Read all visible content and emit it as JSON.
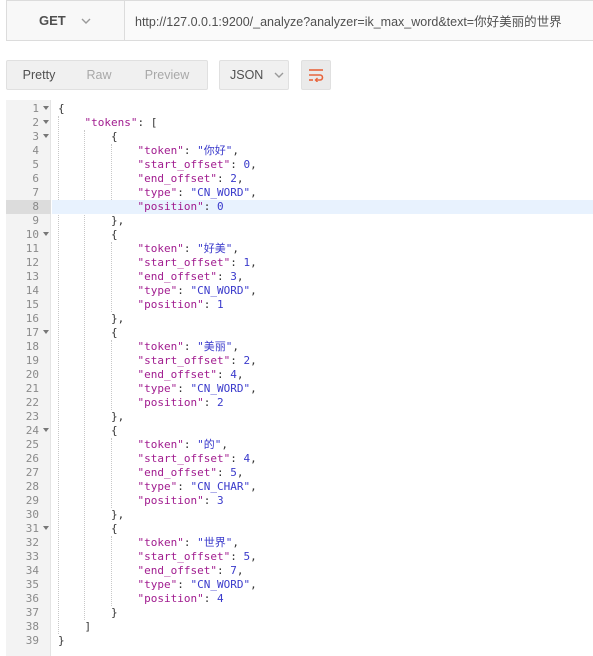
{
  "request": {
    "method": "GET",
    "url": "http://127.0.0.1:9200/_analyze?analyzer=ik_max_word&text=你好美丽的世界"
  },
  "toolbar": {
    "views": [
      "Pretty",
      "Raw",
      "Preview"
    ],
    "active_view": "Pretty",
    "format": "JSON",
    "wrap_icon": "wrap-lines-icon"
  },
  "colors": {
    "key": "#a11c8f",
    "string": "#3a3acb",
    "number": "#3a3acb",
    "punct": "#333333",
    "active_line": "#e8f2fe",
    "wrap_icon": "#e8643c"
  },
  "editor": {
    "active_line": 8,
    "lines": [
      "{",
      "    \"tokens\": [",
      "        {",
      "            \"token\": \"你好\",",
      "            \"start_offset\": 0,",
      "            \"end_offset\": 2,",
      "            \"type\": \"CN_WORD\",",
      "            \"position\": 0",
      "        },",
      "        {",
      "            \"token\": \"好美\",",
      "            \"start_offset\": 1,",
      "            \"end_offset\": 3,",
      "            \"type\": \"CN_WORD\",",
      "            \"position\": 1",
      "        },",
      "        {",
      "            \"token\": \"美丽\",",
      "            \"start_offset\": 2,",
      "            \"end_offset\": 4,",
      "            \"type\": \"CN_WORD\",",
      "            \"position\": 2",
      "        },",
      "        {",
      "            \"token\": \"的\",",
      "            \"start_offset\": 4,",
      "            \"end_offset\": 5,",
      "            \"type\": \"CN_CHAR\",",
      "            \"position\": 3",
      "        },",
      "        {",
      "            \"token\": \"世界\",",
      "            \"start_offset\": 5,",
      "            \"end_offset\": 7,",
      "            \"type\": \"CN_WORD\",",
      "            \"position\": 4",
      "        }",
      "    ]",
      "}"
    ],
    "fold_lines": [
      1,
      2,
      3,
      10,
      17,
      24,
      31
    ]
  }
}
